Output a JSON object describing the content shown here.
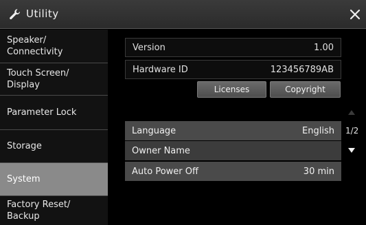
{
  "window": {
    "title": "Utility",
    "icon": "wrench-icon",
    "close_icon": "close-icon"
  },
  "sidebar": {
    "items": [
      {
        "label": "Speaker/\nConnectivity",
        "selected": false
      },
      {
        "label": "Touch Screen/\nDisplay",
        "selected": false
      },
      {
        "label": "Parameter Lock",
        "selected": false
      },
      {
        "label": "Storage",
        "selected": false
      },
      {
        "label": "System",
        "selected": true
      },
      {
        "label": "Factory Reset/\nBackup",
        "selected": false
      }
    ]
  },
  "info": {
    "version_label": "Version",
    "version_value": "1.00",
    "hardware_label": "Hardware ID",
    "hardware_value": "123456789AB"
  },
  "buttons": {
    "licenses": "Licenses",
    "copyright": "Copyright"
  },
  "settings": [
    {
      "label": "Language",
      "value": "English"
    },
    {
      "label": "Owner Name",
      "value": ""
    },
    {
      "label": "Auto Power Off",
      "value": "30 min"
    }
  ],
  "pager": {
    "text": "1/2"
  },
  "colors": {
    "selected_item": "#8a8a8a",
    "setting_row": "#4a4a4a",
    "button": "#5c5c5c"
  }
}
